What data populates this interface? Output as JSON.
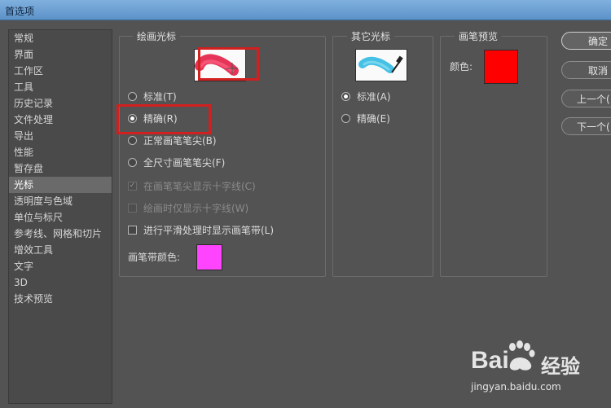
{
  "window": {
    "title": "首选项"
  },
  "sidebar": {
    "items": [
      {
        "label": "常规"
      },
      {
        "label": "界面"
      },
      {
        "label": "工作区"
      },
      {
        "label": "工具"
      },
      {
        "label": "历史记录"
      },
      {
        "label": "文件处理"
      },
      {
        "label": "导出"
      },
      {
        "label": "性能"
      },
      {
        "label": "暂存盘"
      },
      {
        "label": "光标",
        "selected": true
      },
      {
        "label": "透明度与色域"
      },
      {
        "label": "单位与标尺"
      },
      {
        "label": "参考线、网格和切片"
      },
      {
        "label": "增效工具"
      },
      {
        "label": "文字"
      },
      {
        "label": "3D"
      },
      {
        "label": "技术预览"
      }
    ]
  },
  "painting_cursors": {
    "title": "绘画光标",
    "options": [
      {
        "label": "标准(T)",
        "checked": false
      },
      {
        "label": "精确(R)",
        "checked": true
      },
      {
        "label": "正常画笔笔尖(B)",
        "checked": false
      },
      {
        "label": "全尺寸画笔笔尖(F)",
        "checked": false
      }
    ],
    "checkboxes": [
      {
        "label": "在画笔笔尖显示十字线(C)",
        "checked": true,
        "disabled": true
      },
      {
        "label": "绘画时仅显示十字线(W)",
        "checked": false,
        "disabled": true
      },
      {
        "label": "进行平滑处理时显示画笔带(L)",
        "checked": false,
        "disabled": false
      }
    ],
    "brush_leash_color_label": "画笔带颜色:",
    "brush_leash_color": "#ff44ff"
  },
  "other_cursors": {
    "title": "其它光标",
    "options": [
      {
        "label": "标准(A)",
        "checked": true
      },
      {
        "label": "精确(E)",
        "checked": false
      }
    ]
  },
  "brush_preview": {
    "title": "画笔预览",
    "color_label": "颜色:",
    "color": "#ff0000"
  },
  "buttons": {
    "ok": "确定",
    "cancel": "取消",
    "prev": "上一个(",
    "next": "下一个("
  },
  "watermark": {
    "brand": "Bai",
    "brand_cn": "经验",
    "url": "jingyan.baidu.com"
  },
  "colors": {
    "highlight": "#d21f1f",
    "dialog_bg": "#535353"
  }
}
